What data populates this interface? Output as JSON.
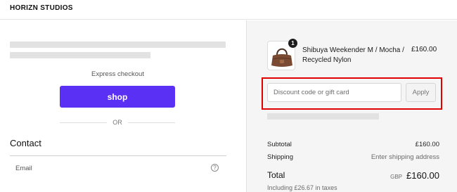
{
  "header": {
    "logo": "HORIZN STUDIOS"
  },
  "express": {
    "label": "Express checkout",
    "shop_button": "shop",
    "or_text": "OR"
  },
  "contact": {
    "title": "Contact",
    "email_label": "Email",
    "help_icon": "?"
  },
  "order": {
    "item": {
      "name": "Shibuya Weekender M / Mocha / Recycled Nylon",
      "price": "£160.00",
      "quantity": "1",
      "thumbnail_icon": "weekender-bag-image"
    },
    "discount": {
      "placeholder": "Discount code or gift card",
      "apply_label": "Apply"
    },
    "subtotal_label": "Subtotal",
    "subtotal_value": "£160.00",
    "shipping_label": "Shipping",
    "shipping_value": "Enter shipping address",
    "total_label": "Total",
    "total_currency": "GBP",
    "total_value": "£160.00",
    "taxes_note": "Including £26.67 in taxes"
  },
  "colors": {
    "shop_button": "#5a31f4",
    "highlight": "#e00000",
    "summary_background": "#f5f5f5"
  }
}
